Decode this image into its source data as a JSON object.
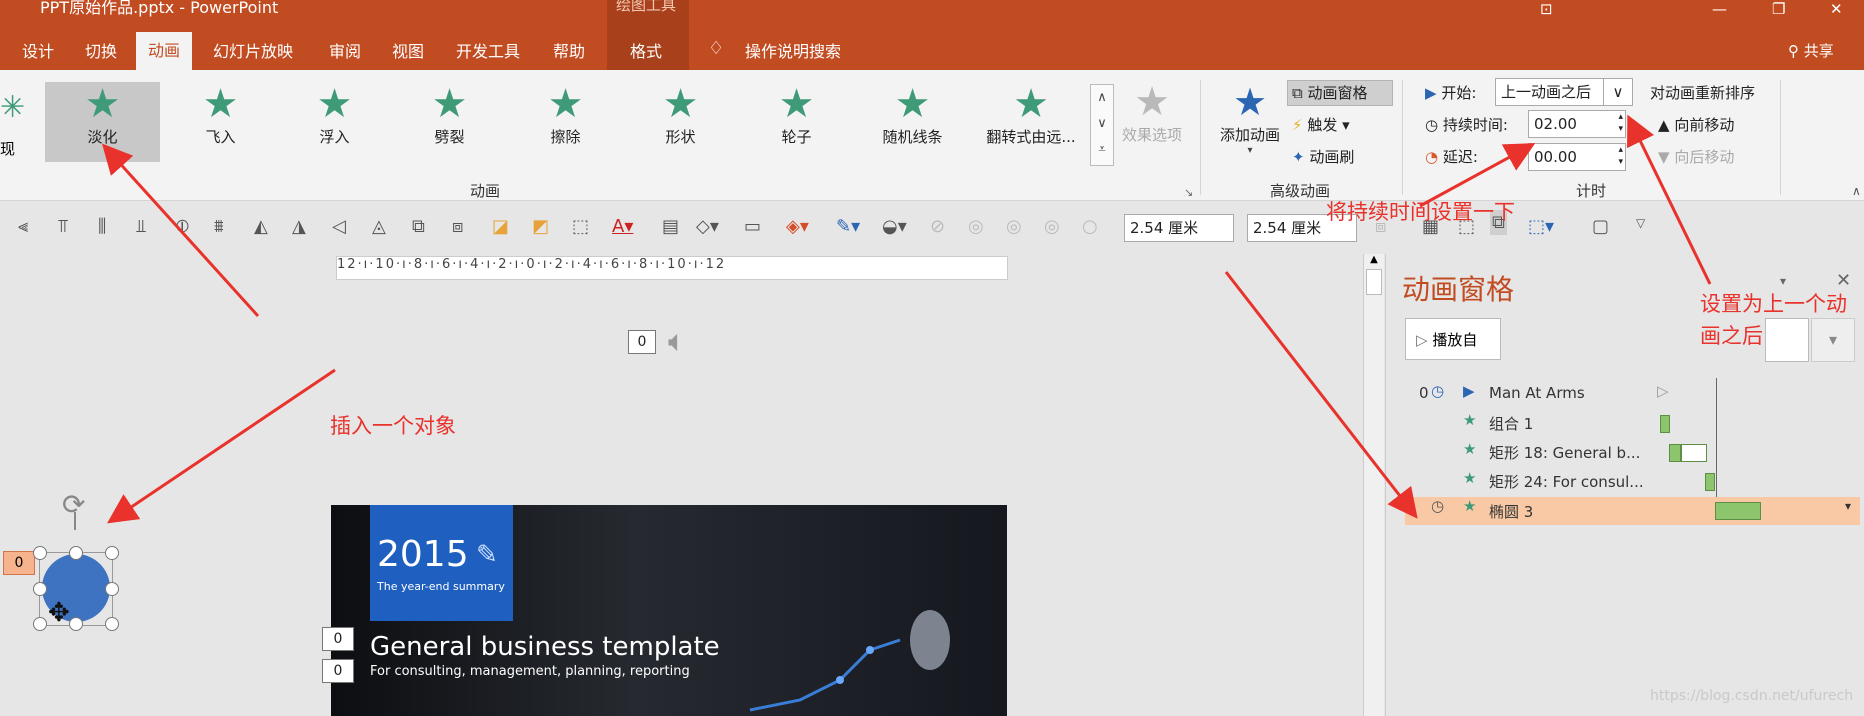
{
  "title": {
    "text": "PPT原始作品.pptx - PowerPoint",
    "context_group": "绘图工具"
  },
  "tabs": [
    {
      "label": "设计"
    },
    {
      "label": "切换"
    },
    {
      "label": "动画"
    },
    {
      "label": "幻灯片放映"
    },
    {
      "label": "审阅"
    },
    {
      "label": "视图"
    },
    {
      "label": "开发工具"
    },
    {
      "label": "帮助"
    }
  ],
  "context_tab": "格式",
  "search_tell": "操作说明搜索",
  "share": "共享",
  "gallery": [
    {
      "label": "淡化",
      "selected": true
    },
    {
      "label": "飞入"
    },
    {
      "label": "浮入"
    },
    {
      "label": "劈裂"
    },
    {
      "label": "擦除"
    },
    {
      "label": "形状"
    },
    {
      "label": "轮子"
    },
    {
      "label": "随机线条"
    },
    {
      "label": "翻转式由远..."
    }
  ],
  "effect_options": "效果选项",
  "group_animation": "动画",
  "add_animation": "添加动画",
  "animation_pane_btn": "动画窗格",
  "trigger": "触发",
  "painter": "动画刷",
  "group_advanced": "高级动画",
  "timing": {
    "start_label": "开始:",
    "start_value": "上一动画之后",
    "duration_label": "持续时间:",
    "duration_value": "02.00",
    "delay_label": "延迟:",
    "delay_value": "00.00",
    "reorder_label": "对动画重新排序",
    "move_earlier": "向前移动",
    "move_later": "向后移动",
    "group_label": "计时"
  },
  "size": {
    "height": "2.54 厘米",
    "width": "2.54 厘米"
  },
  "ruler_text": "12·ı·10·ı·8·ı·6·ı·4·ı·2·ı·0·ı·2·ı·4·ı·6·ı·8·ı·10·ı·12",
  "slide": {
    "year": "2015",
    "year_sub": "The year-end summary",
    "heading": "General business template",
    "subheading": "For consulting, management, planning, reporting"
  },
  "tags": {
    "audio": "0",
    "slide_top": "0",
    "heading": "0",
    "sub": "0",
    "circle": "0"
  },
  "pane": {
    "title": "动画窗格",
    "play_from": "播放自",
    "rows": [
      {
        "index": "0",
        "label": "Man At Arms"
      },
      {
        "index": "",
        "label": "组合 1"
      },
      {
        "index": "",
        "label": "矩形 18: General b..."
      },
      {
        "index": "",
        "label": "矩形 24: For consul..."
      },
      {
        "index": "",
        "label": "椭圆 3",
        "selected": true
      }
    ]
  },
  "annotations": {
    "insert_object": "插入一个对象",
    "set_duration": "将持续时间设置一下",
    "set_after": "设置为上一个动画之后"
  },
  "watermark": "https://blog.csdn.net/ufurech",
  "colors": {
    "brand": "#c24c22",
    "annotation": "#e8322b",
    "star": "#3f9a78",
    "shape": "#3e73c1"
  }
}
